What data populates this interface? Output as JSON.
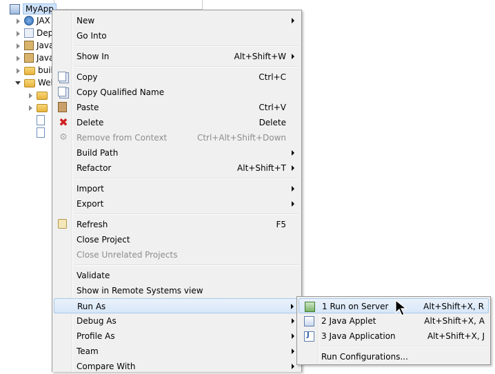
{
  "tree": {
    "root_label": "MyApp",
    "items": [
      {
        "label": "JAX",
        "icon": "web-service-icon",
        "expander": "closed"
      },
      {
        "label": "Dep",
        "icon": "deployment-descriptor-icon",
        "expander": "closed"
      },
      {
        "label": "Java",
        "icon": "java-resources-icon",
        "expander": "closed"
      },
      {
        "label": "Java",
        "icon": "library-jar-icon",
        "expander": "closed"
      },
      {
        "label": "buil",
        "icon": "folder-icon",
        "expander": "closed"
      },
      {
        "label": "Web",
        "icon": "folder-icon",
        "expander": "open"
      }
    ]
  },
  "context_menu": {
    "items": [
      {
        "label": "New",
        "submenu": true
      },
      {
        "label": "Go Into"
      },
      {
        "label": "Show In",
        "shortcut": "Alt+Shift+W",
        "submenu": true
      },
      {
        "label": "Copy",
        "shortcut": "Ctrl+C",
        "icon": "copy-icon"
      },
      {
        "label": "Copy Qualified Name",
        "icon": "copy-qualified-name-icon"
      },
      {
        "label": "Paste",
        "shortcut": "Ctrl+V",
        "icon": "paste-icon"
      },
      {
        "label": "Delete",
        "shortcut": "Delete",
        "icon": "delete-icon"
      },
      {
        "label": "Remove from Context",
        "shortcut": "Ctrl+Alt+Shift+Down",
        "icon": "remove-context-icon",
        "disabled": true
      },
      {
        "label": "Build Path",
        "submenu": true
      },
      {
        "label": "Refactor",
        "shortcut": "Alt+Shift+T",
        "submenu": true
      },
      {
        "label": "Import",
        "submenu": true
      },
      {
        "label": "Export",
        "submenu": true
      },
      {
        "label": "Refresh",
        "shortcut": "F5",
        "icon": "refresh-icon"
      },
      {
        "label": "Close Project"
      },
      {
        "label": "Close Unrelated Projects",
        "disabled": true
      },
      {
        "label": "Validate"
      },
      {
        "label": "Show in Remote Systems view"
      },
      {
        "label": "Run As",
        "submenu": true,
        "highlighted": true
      },
      {
        "label": "Debug As",
        "submenu": true
      },
      {
        "label": "Profile As",
        "submenu": true
      },
      {
        "label": "Team",
        "submenu": true
      },
      {
        "label": "Compare With",
        "submenu": true
      }
    ]
  },
  "run_as_submenu": {
    "items": [
      {
        "label": "1 Run on Server",
        "shortcut": "Alt+Shift+X, R",
        "icon": "run-on-server-icon",
        "highlighted": true
      },
      {
        "label": "2 Java Applet",
        "shortcut": "Alt+Shift+X, A",
        "icon": "java-applet-icon"
      },
      {
        "label": "3 Java Application",
        "shortcut": "Alt+Shift+X, J",
        "icon": "java-application-icon"
      },
      {
        "label": "Run Configurations..."
      }
    ]
  },
  "colors": {
    "menu_background": "#f0f0f0",
    "highlight": "#d7e6f8",
    "disabled_text": "#8d8d8d",
    "selection": "#cfe3fb"
  }
}
